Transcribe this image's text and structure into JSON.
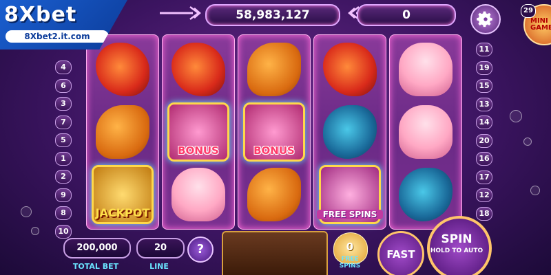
{
  "watermark": {
    "brand": "8Xbet",
    "url": "8Xbet2.it.com"
  },
  "top_bar": {
    "balance": "58,983,127",
    "win": "0"
  },
  "mini_game": {
    "label": "MINI GAME",
    "count": "29"
  },
  "paylines": {
    "left": [
      "4",
      "6",
      "3",
      "7",
      "5",
      "1",
      "2",
      "9",
      "8",
      "10"
    ],
    "right": [
      "11",
      "19",
      "15",
      "13",
      "14",
      "20",
      "16",
      "17",
      "12",
      "18"
    ]
  },
  "reels": [
    [
      {
        "symbol": "red-piranha-fish",
        "label": ""
      },
      {
        "symbol": "orange-fish",
        "label": ""
      },
      {
        "symbol": "jackpot-trident",
        "label": "JACKPOT"
      }
    ],
    [
      {
        "symbol": "red-piranha-fish",
        "label": ""
      },
      {
        "symbol": "bonus-bottle",
        "label": "BONUS"
      },
      {
        "symbol": "pink-shell-creature",
        "label": ""
      }
    ],
    [
      {
        "symbol": "orange-fish",
        "label": ""
      },
      {
        "symbol": "bonus-bottle",
        "label": "BONUS"
      },
      {
        "symbol": "orange-fish",
        "label": ""
      }
    ],
    [
      {
        "symbol": "red-piranha-fish",
        "label": ""
      },
      {
        "symbol": "blue-anglerfish",
        "label": ""
      },
      {
        "symbol": "free-spins-pearl",
        "label": "FREE SPINS"
      }
    ],
    [
      {
        "symbol": "pink-shell-creature",
        "label": ""
      },
      {
        "symbol": "pink-shell-creature",
        "label": ""
      },
      {
        "symbol": "blue-anglerfish",
        "label": ""
      }
    ]
  ],
  "controls": {
    "total_bet_value": "200,000",
    "total_bet_label": "TOTAL BET",
    "line_value": "20",
    "line_label": "LINE",
    "help_label": "?",
    "free_spins_count": "0",
    "free_spins_label": "FREE SPINS",
    "fast_label": "FAST",
    "spin_label": "SPIN",
    "spin_sub": "HOLD TO AUTO"
  },
  "colors": {
    "reel_glow": "#ff6ad8",
    "caption_cyan": "#6ae4ff",
    "gold_border": "#ffc56a"
  }
}
